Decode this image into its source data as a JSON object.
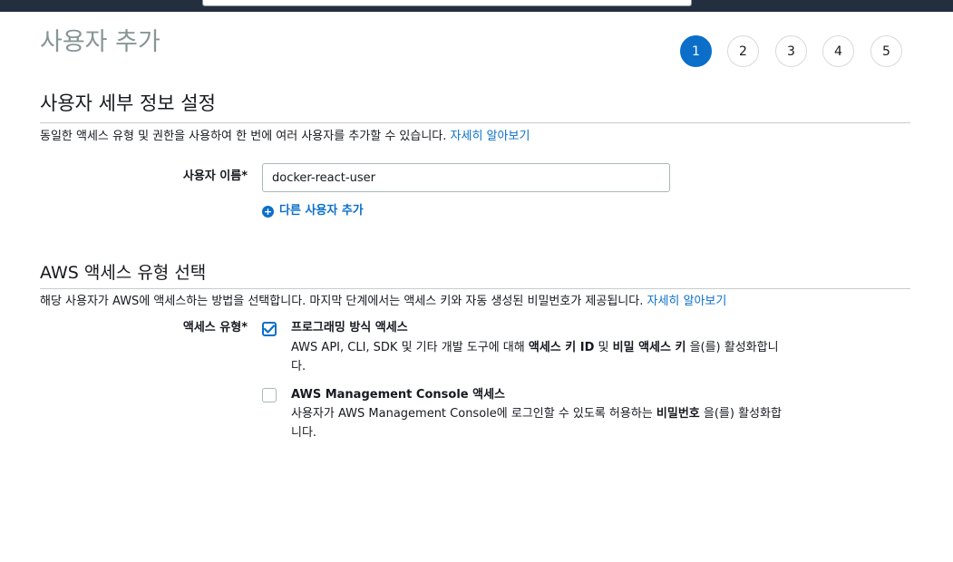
{
  "page_title": "사용자 추가",
  "steps": [
    "1",
    "2",
    "3",
    "4",
    "5"
  ],
  "active_step": 1,
  "details_section": {
    "title": "사용자 세부 정보 설정",
    "description": "동일한 액세스 유형 및 권한을 사용하여 한 번에 여러 사용자를 추가할 수 있습니다.",
    "learn_more": "자세히 알아보기",
    "username_label": "사용자 이름*",
    "username_value": "docker-react-user",
    "add_user_label": "다른 사용자 추가"
  },
  "access_section": {
    "title": "AWS 액세스 유형 선택",
    "description": "해당 사용자가 AWS에 액세스하는 방법을 선택합니다. 마지막 단계에서는 액세스 키와 자동 생성된 비밀번호가 제공됩니다.",
    "learn_more": "자세히 알아보기",
    "type_label": "액세스 유형*",
    "options": [
      {
        "title": "프로그래밍 방식 액세스",
        "checked": true,
        "desc_pre": "AWS API, CLI, SDK 및 기타 개발 도구에 대해 ",
        "desc_bold1": "액세스 키 ID",
        "desc_mid": " 및 ",
        "desc_bold2": "비밀 액세스 키",
        "desc_post": " 을(를) 활성화합니다."
      },
      {
        "title": "AWS Management Console 액세스",
        "checked": false,
        "desc_pre": "사용자가 AWS Management Console에 로그인할 수 있도록 허용하는 ",
        "desc_bold1": "비밀번호",
        "desc_post": " 을(를) 활성화합니다."
      }
    ]
  },
  "colors": {
    "accent": "#0b6fc9",
    "topbar": "#232f3e",
    "muted_title": "#879596"
  }
}
